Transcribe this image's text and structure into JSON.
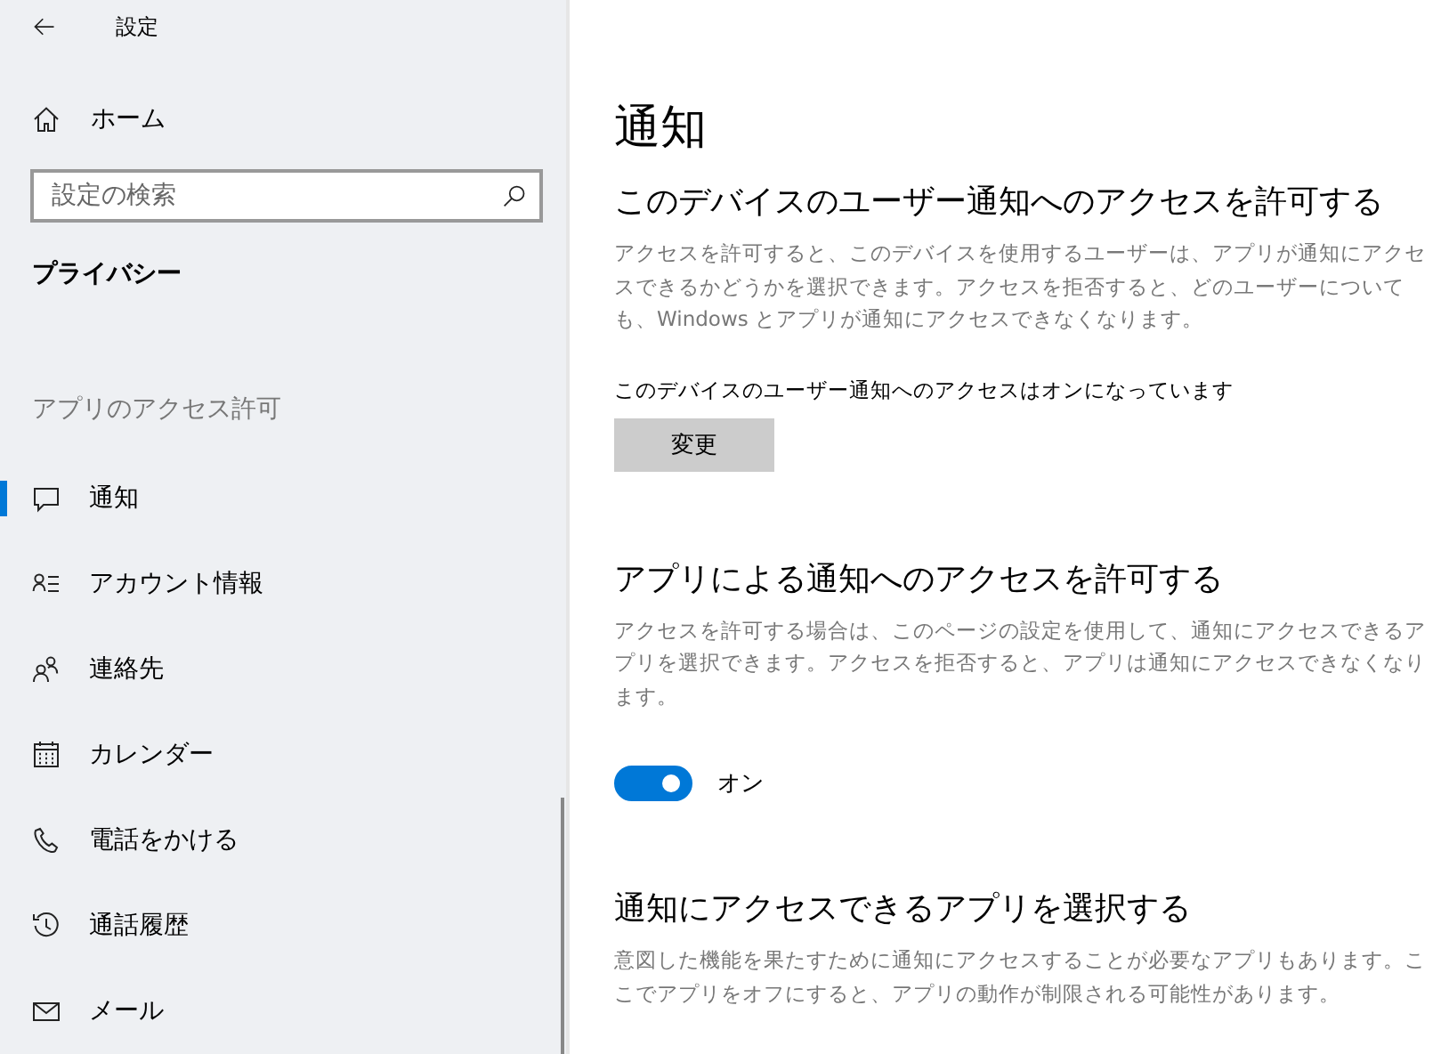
{
  "window": {
    "title": "設定"
  },
  "sidebar": {
    "home": "ホーム",
    "search": {
      "placeholder": "設定の検索"
    },
    "category": "プライバシー",
    "group_label": "アプリのアクセス許可",
    "items": [
      {
        "label": "通知",
        "selected": true
      },
      {
        "label": "アカウント情報",
        "selected": false
      },
      {
        "label": "連絡先",
        "selected": false
      },
      {
        "label": "カレンダー",
        "selected": false
      },
      {
        "label": "電話をかける",
        "selected": false
      },
      {
        "label": "通話履歴",
        "selected": false
      },
      {
        "label": "メール",
        "selected": false
      }
    ]
  },
  "content": {
    "title": "通知",
    "sections": [
      {
        "heading": "このデバイスのユーザー通知へのアクセスを許可する",
        "description": "アクセスを許可すると、このデバイスを使用するユーザーは、アプリが通知にアクセスできるかどうかを選択できます。アクセスを拒否すると、どのユーザーについても、Windows とアプリが通知にアクセスできなくなります。",
        "status": "このデバイスのユーザー通知へのアクセスはオンになっています",
        "button": "変更"
      },
      {
        "heading": "アプリによる通知へのアクセスを許可する",
        "description": "アクセスを許可する場合は、このページの設定を使用して、通知にアクセスできるアプリを選択できます。アクセスを拒否すると、アプリは通知にアクセスできなくなります。",
        "toggle": {
          "on": true,
          "label": "オン"
        }
      },
      {
        "heading": "通知にアクセスできるアプリを選択する",
        "description": "意図した機能を果たすために通知にアクセスすることが必要なアプリもあります。ここでアプリをオフにすると、アプリの動作が制限される可能性があります。"
      }
    ]
  }
}
